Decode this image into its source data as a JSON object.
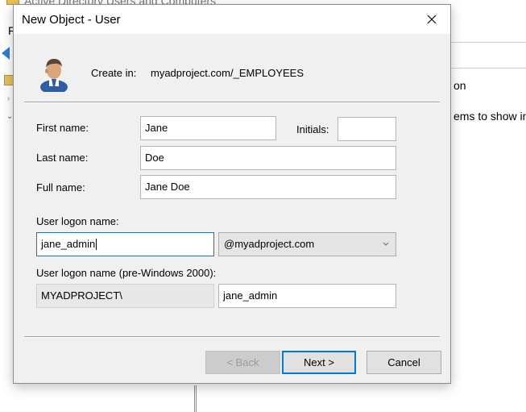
{
  "background_window": {
    "title": "Active Directory Users and Computers",
    "menu_first": "F",
    "column_header": "on",
    "empty_message": "ems to show in"
  },
  "dialog": {
    "title": "New Object - User",
    "create_in_label": "Create in:",
    "create_in_path": "myadproject.com/_EMPLOYEES",
    "first_name": {
      "label": "First name:",
      "value": "Jane"
    },
    "initials": {
      "label": "Initials:",
      "value": ""
    },
    "last_name": {
      "label": "Last name:",
      "value": "Doe"
    },
    "full_name": {
      "label": "Full name:",
      "value": "Jane Doe"
    },
    "logon": {
      "label": "User logon name:",
      "value": "jane_admin",
      "domain": "@myadproject.com"
    },
    "pre2000": {
      "label": "User logon name (pre-Windows 2000):",
      "domain": "MYADPROJECT\\",
      "value": "jane_admin"
    },
    "buttons": {
      "back": "< Back",
      "next": "Next >",
      "cancel": "Cancel"
    }
  },
  "icons": {
    "close": "close-icon",
    "user": "user-icon",
    "dropdown": "chevron-down-icon"
  },
  "colors": {
    "accent": "#0078d7",
    "dialog_bg": "#f0f0f0"
  }
}
